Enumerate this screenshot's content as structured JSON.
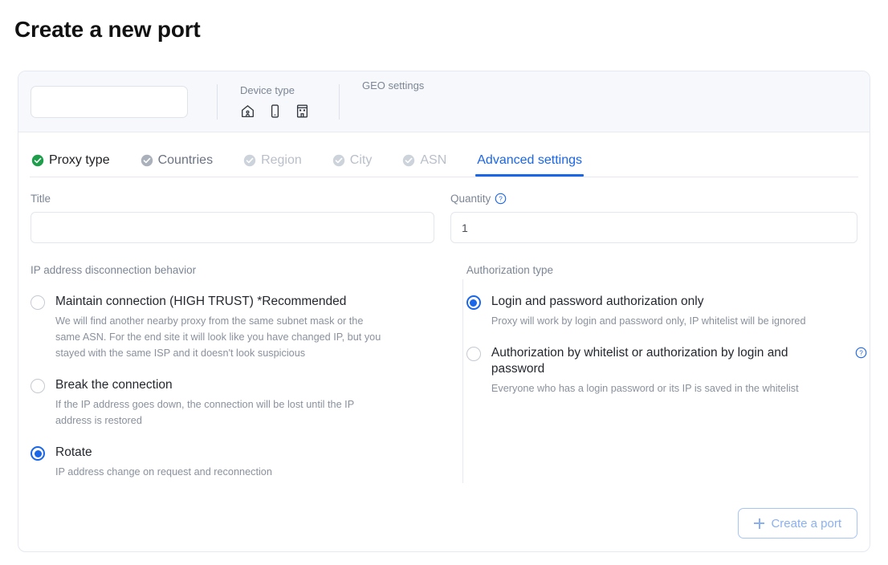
{
  "page": {
    "title": "Create a new port"
  },
  "header": {
    "search": {
      "value": "",
      "placeholder": ""
    },
    "device_type": {
      "label": "Device type",
      "icons": [
        "home-icon",
        "mobile-icon",
        "building-icon"
      ]
    },
    "geo": {
      "label": "GEO settings"
    }
  },
  "tabs": [
    {
      "label": "Proxy type",
      "state": "done",
      "icon": "check-circle-green-icon"
    },
    {
      "label": "Countries",
      "state": "done-dim",
      "icon": "check-circle-gray-icon"
    },
    {
      "label": "Region",
      "state": "disabled",
      "icon": "check-circle-light-icon"
    },
    {
      "label": "City",
      "state": "disabled",
      "icon": "check-circle-light-icon"
    },
    {
      "label": "ASN",
      "state": "disabled",
      "icon": "check-circle-light-icon"
    },
    {
      "label": "Advanced settings",
      "state": "active",
      "icon": ""
    }
  ],
  "fields": {
    "title": {
      "label": "Title",
      "value": "",
      "placeholder": ""
    },
    "quantity": {
      "label": "Quantity",
      "value": "1",
      "placeholder": "",
      "help_icon": "question-circle-icon"
    }
  },
  "disconnect": {
    "group_label": "IP address disconnection behavior",
    "options": [
      {
        "title": "Maintain connection (HIGH TRUST) *Recommended",
        "desc": "We will find another nearby proxy from the same subnet mask or the same ASN. For the end site it will look like you have changed IP, but you stayed with the same ISP and it doesn't look suspicious",
        "selected": false
      },
      {
        "title": "Break the connection",
        "desc": "If the IP address goes down, the connection will be lost until the IP address is restored",
        "selected": false
      },
      {
        "title": "Rotate",
        "desc": "IP address change on request and reconnection",
        "selected": true
      }
    ]
  },
  "authorization": {
    "group_label": "Authorization type",
    "options": [
      {
        "title": "Login and password authorization only",
        "desc": "Proxy will work by login and password only, IP whitelist will be ignored",
        "selected": true,
        "help_icon": ""
      },
      {
        "title": "Authorization by whitelist or authorization by login and password",
        "desc": "Everyone who has a login password or its IP is saved in the whitelist",
        "selected": false,
        "help_icon": "question-circle-icon"
      }
    ]
  },
  "footer": {
    "create_label": "Create a port",
    "create_icon": "plus-icon"
  },
  "colors": {
    "accent_blue": "#1a66e8",
    "button_blue": "#8ab0f2",
    "check_green": "#1e9e4a",
    "check_gray": "#aab1bb",
    "check_light": "#cdd3db",
    "label_gray": "#7c8694",
    "desc_gray": "#8a919d",
    "header_bg": "#f6f8fb",
    "border": "#e4e8f0"
  }
}
